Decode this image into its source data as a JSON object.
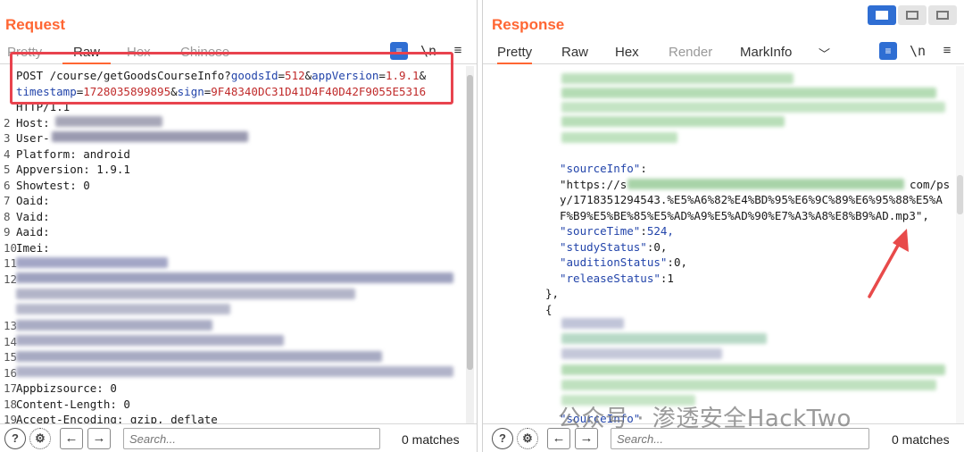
{
  "layout_buttons": [
    "split-vertical",
    "split-horizontal",
    "single"
  ],
  "request": {
    "title": "Request",
    "tabs": [
      "Pretty",
      "Raw",
      "Hex",
      "Chinese"
    ],
    "active_tab": "Raw",
    "toolbar": {
      "newline_label": "\\n",
      "menu_icon": "hamburger-menu-icon"
    },
    "request_line": {
      "method_path": "POST /course/getGoodsCourseInfo?",
      "p1_name": "goodsId",
      "p1_value": "512",
      "p2_name": "appVersion",
      "p2_value": "1.9.1",
      "p3_name": "timestamp",
      "p3_value": "1728035899895",
      "p4_name": "sign",
      "p4_value": "9F48340DC31D41D4F40D42F9055E5316"
    },
    "lines": [
      {
        "n": "",
        "text": "HTTP/1.1"
      },
      {
        "n": "2",
        "text": "Host:"
      },
      {
        "n": "3",
        "text": "User-"
      },
      {
        "n": "4",
        "text": "Platform: android"
      },
      {
        "n": "5",
        "text": "Appversion: 1.9.1"
      },
      {
        "n": "6",
        "text": "Showtest: 0"
      },
      {
        "n": "7",
        "text": "Oaid:"
      },
      {
        "n": "8",
        "text": "Vaid:"
      },
      {
        "n": "9",
        "text": "Aaid:"
      },
      {
        "n": "10",
        "text": "Imei:"
      },
      {
        "n": "11",
        "text": ""
      },
      {
        "n": "12",
        "text": ""
      },
      {
        "n": "",
        "text": ""
      },
      {
        "n": "",
        "text": ""
      },
      {
        "n": "13",
        "text": ""
      },
      {
        "n": "14",
        "text": ""
      },
      {
        "n": "15",
        "text": ""
      },
      {
        "n": "16",
        "text": ""
      },
      {
        "n": "17",
        "text": "Appbizsource: 0"
      },
      {
        "n": "18",
        "text": "Content-Length: 0"
      },
      {
        "n": "19",
        "text": "Accept-Encoding: gzip, deflate"
      }
    ],
    "search_placeholder": "Search...",
    "matches": "0 matches"
  },
  "response": {
    "title": "Response",
    "tabs": [
      "Pretty",
      "Raw",
      "Hex",
      "Render",
      "MarkInfo"
    ],
    "active_tab": "Pretty",
    "toolbar": {
      "newline_label": "\\n",
      "menu_icon": "hamburger-menu-icon"
    },
    "json": {
      "k1": "\"sourceInfo\"",
      "v1_start": "\"https://s",
      "v1_end": "com/ps",
      "v1_line2": "y/1718351294543.%E5%A6%82%E4%BD%95%E6%9C%89%E6%95%88%E5%A",
      "v1_line3": "F%B9%E5%BE%85%E5%AD%A9%E5%AD%90%E7%A3%A8%E8%B9%AD.mp3\",",
      "k2": "\"sourceTime\"",
      "v2": "524,",
      "k3": "\"studyStatus\"",
      "v3": "0,",
      "k4": "\"auditionStatus\"",
      "v4": "0,",
      "k5": "\"releaseStatus\"",
      "v5": "1",
      "close": "},",
      "open": "{",
      "k6": "\"sourceInfo\""
    },
    "search_placeholder": "Search...",
    "matches": "0 matches"
  },
  "watermark": "公众号 · 渗透安全HackTwo",
  "colors": {
    "accent": "#ff6633",
    "highlight_box": "#e8434e",
    "arrow": "#e84a4a",
    "json_green": "#178a17"
  }
}
